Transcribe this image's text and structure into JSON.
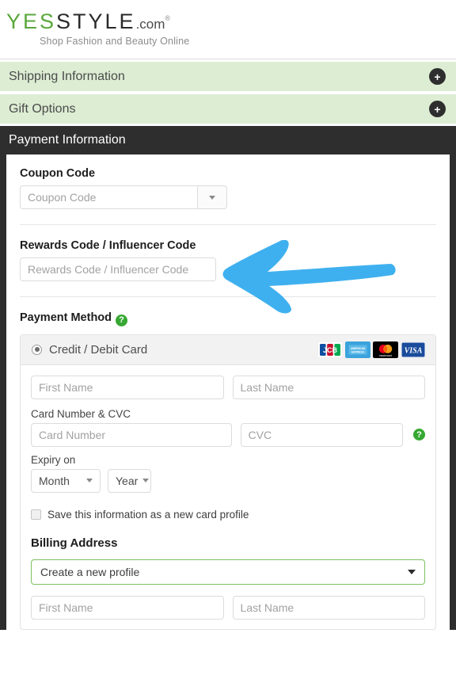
{
  "logo": {
    "yes": "YES",
    "style": "STYLE",
    "com": ".com",
    "registered": "®",
    "tagline": "Shop Fashion and Beauty Online"
  },
  "accordions": [
    {
      "title": "Shipping Information",
      "toggle": "+",
      "icon": "plus-icon"
    },
    {
      "title": "Gift Options",
      "toggle": "+",
      "icon": "plus-icon"
    }
  ],
  "payment_section": {
    "header": "Payment Information",
    "coupon": {
      "label": "Coupon Code",
      "placeholder": "Coupon Code",
      "value": ""
    },
    "rewards": {
      "label": "Rewards Code / Influencer Code",
      "placeholder": "Rewards Code / Influencer Code",
      "value": ""
    },
    "payment_method": {
      "label": "Payment Method",
      "help": "?",
      "option_label": "Credit / Debit Card",
      "option_selected": true,
      "card_logos": [
        {
          "name": "jcb-logo",
          "text": "JCB"
        },
        {
          "name": "amex-logo",
          "text": "AMERICAN EXPRESS"
        },
        {
          "name": "mastercard-logo",
          "text": "mastercard"
        },
        {
          "name": "visa-logo",
          "text": "VISA"
        }
      ],
      "first_name_placeholder": "First Name",
      "last_name_placeholder": "Last Name",
      "card_label": "Card Number & CVC",
      "card_number_placeholder": "Card Number",
      "cvc_placeholder": "CVC",
      "cvc_help": "?",
      "expiry_label": "Expiry on",
      "month_value": "Month",
      "year_value": "Year",
      "save_card_label": "Save this information as a new card profile",
      "save_card_checked": false
    },
    "billing": {
      "title": "Billing Address",
      "profile_value": "Create a new profile",
      "first_name_placeholder": "First Name",
      "last_name_placeholder": "Last Name"
    }
  },
  "annotation": {
    "type": "arrow",
    "direction": "left",
    "color": "#3fb0ef",
    "points_to": "Rewards Code / Influencer Code"
  },
  "colors": {
    "accent_green": "#5aa83c",
    "accordion_bg": "#dcedd3",
    "panel_dark": "#2e2e2e",
    "help_green": "#36a832",
    "arrow_blue": "#3fb0ef"
  }
}
